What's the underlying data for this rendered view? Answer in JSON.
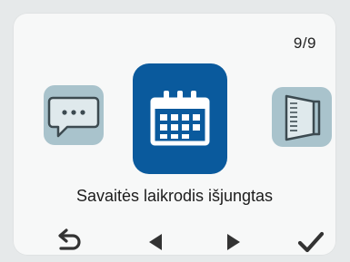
{
  "header": {
    "page_counter": "9/9"
  },
  "menu": {
    "items": [
      {
        "icon": "message-icon",
        "state": "inactive"
      },
      {
        "icon": "calendar-icon",
        "state": "selected"
      },
      {
        "icon": "door-icon",
        "state": "inactive"
      }
    ],
    "selected_label": "Savaitės laikrodis išjungtas"
  },
  "controls": {
    "buttons": [
      {
        "icon": "back-icon"
      },
      {
        "icon": "prev-icon"
      },
      {
        "icon": "next-icon"
      },
      {
        "icon": "confirm-icon"
      }
    ]
  },
  "colors": {
    "selected_tile": "#0a5a9d",
    "inactive_tile": "#a9c3cc",
    "screen_bg": "#f7f8f8",
    "text": "#1c1c1c"
  }
}
